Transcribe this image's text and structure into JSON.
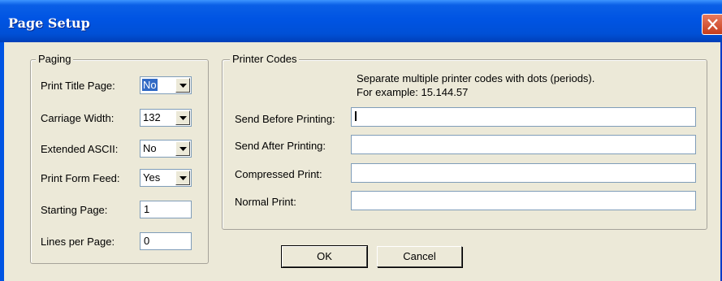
{
  "window": {
    "title": "Page Setup",
    "close_icon": "close-icon"
  },
  "paging": {
    "legend": "Paging",
    "print_title_page": {
      "label": "Print Title Page:",
      "value": "No"
    },
    "carriage_width": {
      "label": "Carriage Width:",
      "value": "132"
    },
    "extended_ascii": {
      "label": "Extended ASCII:",
      "value": "No"
    },
    "print_form_feed": {
      "label": "Print Form Feed:",
      "value": "Yes"
    },
    "starting_page": {
      "label": "Starting Page:",
      "value": "1"
    },
    "lines_per_page": {
      "label": "Lines per Page:",
      "value": "0"
    }
  },
  "printer_codes": {
    "legend": "Printer Codes",
    "hint_line1": "Separate multiple printer codes with dots (periods).",
    "hint_line2": "For example:  15.144.57",
    "send_before": {
      "label": "Send Before Printing:",
      "value": ""
    },
    "send_after": {
      "label": "Send After Printing:",
      "value": ""
    },
    "compressed": {
      "label": "Compressed Print:",
      "value": ""
    },
    "normal": {
      "label": "Normal Print:",
      "value": ""
    }
  },
  "buttons": {
    "ok": "OK",
    "cancel": "Cancel"
  },
  "colors": {
    "titlebar": "#0054e3",
    "dialog_bg": "#ece9d8",
    "selection": "#316ac5",
    "close": "#c63d1c"
  }
}
